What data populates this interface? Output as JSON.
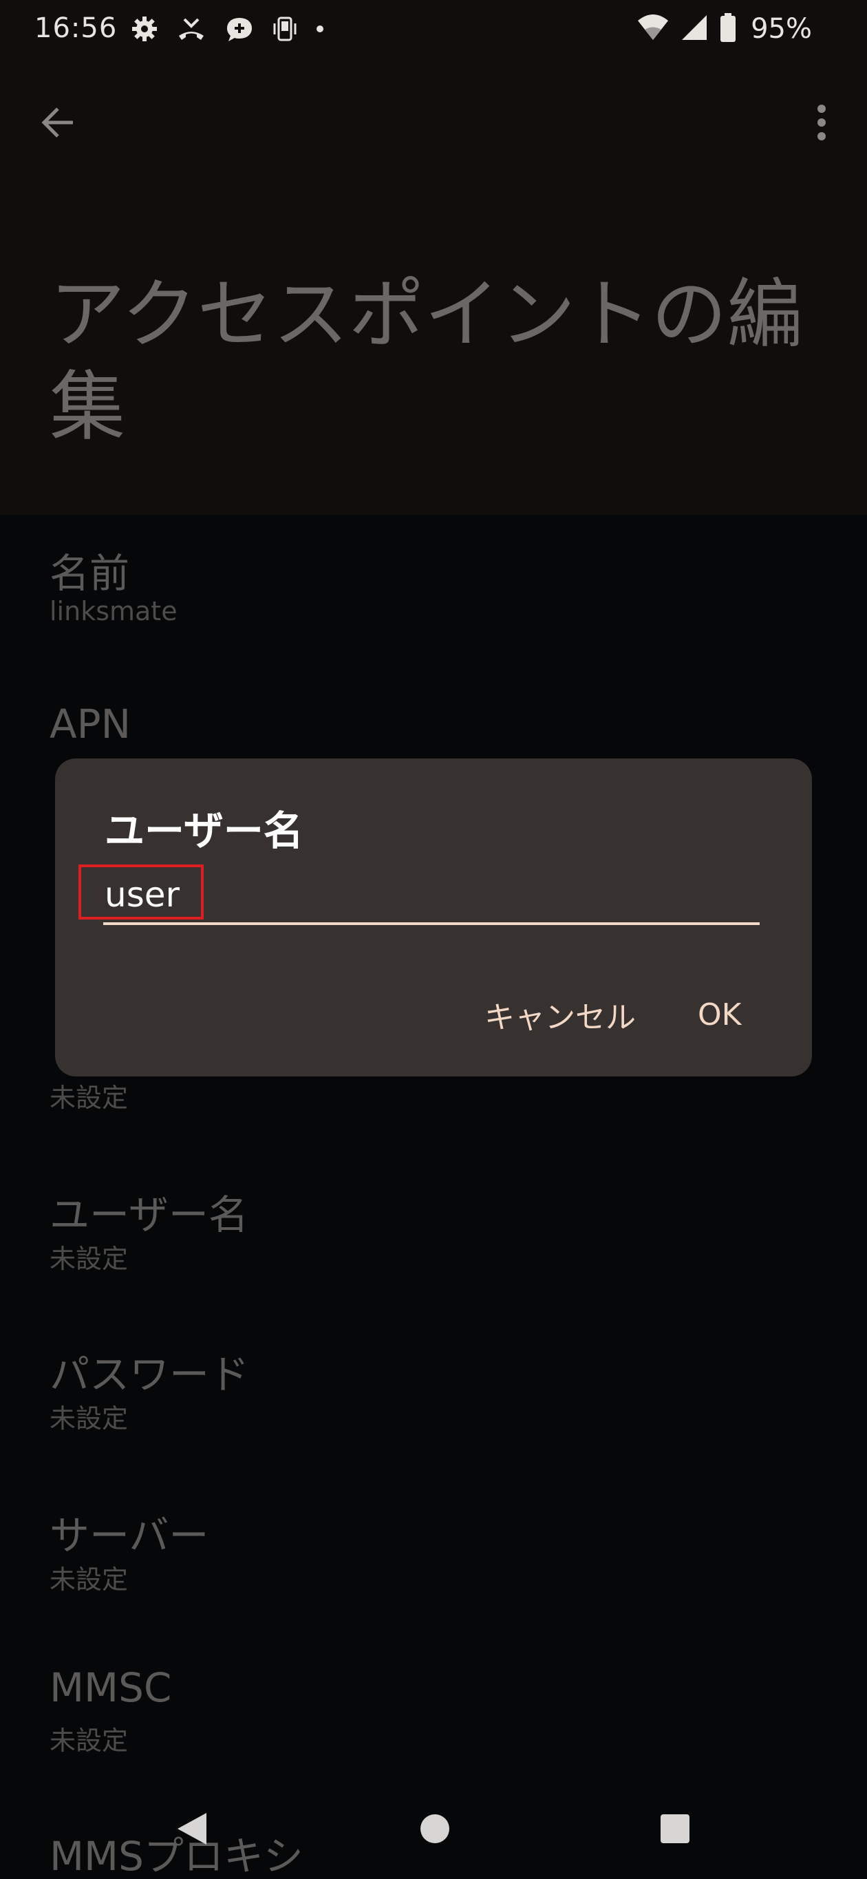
{
  "status_bar": {
    "time": "16:56",
    "icons_left": [
      "settings-icon",
      "missed-call-icon",
      "chat-bubble-icon",
      "phone-vibrate-icon",
      "dot-icon"
    ],
    "icons_right": [
      "wifi-icon",
      "signal-icon",
      "battery-icon"
    ],
    "battery": "95%"
  },
  "app_bar": {
    "back_icon": "arrow-back-icon",
    "more_icon": "more-vert-icon"
  },
  "page": {
    "title": "アクセスポイントの編集"
  },
  "settings": [
    {
      "title": "名前",
      "summary": "linksmate"
    },
    {
      "title": "APN",
      "summary": ""
    },
    {
      "title": "",
      "summary": "未設定"
    },
    {
      "title": "ユーザー名",
      "summary": "未設定"
    },
    {
      "title": "パスワード",
      "summary": "未設定"
    },
    {
      "title": "サーバー",
      "summary": "未設定"
    },
    {
      "title": "MMSC",
      "summary": "未設定"
    },
    {
      "title": "MMSプロキシ",
      "summary": ""
    }
  ],
  "dialog": {
    "title": "ユーザー名",
    "input_value": "user",
    "cancel_label": "キャンセル",
    "ok_label": "OK"
  },
  "nav_bar": {
    "back_icon": "nav-back-icon",
    "home_icon": "nav-home-icon",
    "recents_icon": "nav-recents-icon"
  },
  "colors": {
    "dialog_bg": "#373130",
    "accent": "#f3d8c6",
    "highlight": "#dc1e22",
    "background": "#060708",
    "header_bg": "#100e0d"
  }
}
